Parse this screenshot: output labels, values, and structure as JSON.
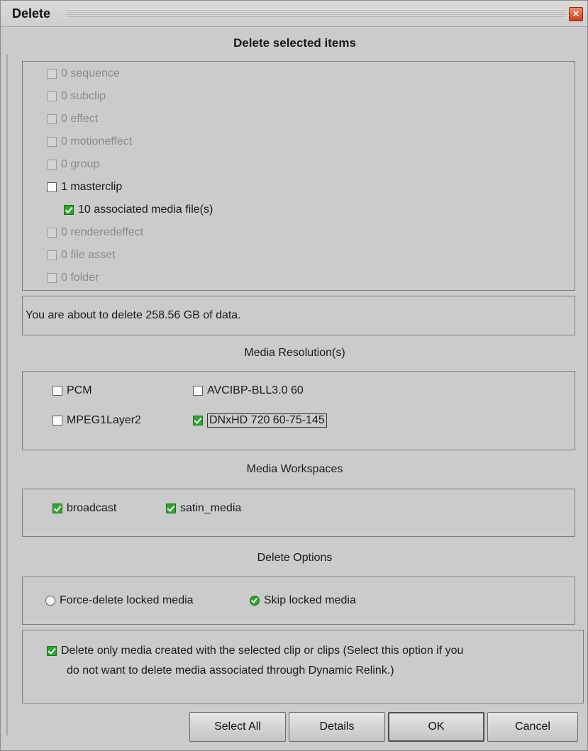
{
  "window": {
    "title": "Delete",
    "close_glyph": "×"
  },
  "heading": "Delete selected items",
  "items": [
    {
      "label": "0 sequence",
      "checked": false,
      "enabled": false,
      "indent": false
    },
    {
      "label": "0 subclip",
      "checked": false,
      "enabled": false,
      "indent": false
    },
    {
      "label": "0 effect",
      "checked": false,
      "enabled": false,
      "indent": false
    },
    {
      "label": "0 motioneffect",
      "checked": false,
      "enabled": false,
      "indent": false
    },
    {
      "label": "0 group",
      "checked": false,
      "enabled": false,
      "indent": false
    },
    {
      "label": "1 masterclip",
      "checked": false,
      "enabled": true,
      "indent": false
    },
    {
      "label": "10 associated media file(s)",
      "checked": true,
      "enabled": true,
      "indent": true
    },
    {
      "label": "0 renderedeffect",
      "checked": false,
      "enabled": false,
      "indent": false
    },
    {
      "label": "0 file asset",
      "checked": false,
      "enabled": false,
      "indent": false
    },
    {
      "label": "0 folder",
      "checked": false,
      "enabled": false,
      "indent": false
    }
  ],
  "summary": "You are about to delete 258.56 GB of data.",
  "media_resolutions": {
    "heading": "Media Resolution(s)",
    "options": [
      {
        "label": "PCM",
        "checked": false
      },
      {
        "label": "AVCIBP-BLL3.0 60",
        "checked": false
      },
      {
        "label": "MPEG1Layer2",
        "checked": false
      },
      {
        "label": "DNxHD 720 60-75-145",
        "checked": true
      }
    ]
  },
  "media_workspaces": {
    "heading": "Media Workspaces",
    "options": [
      {
        "label": "broadcast",
        "checked": true
      },
      {
        "label": "satin_media",
        "checked": true
      }
    ]
  },
  "delete_options": {
    "heading": "Delete Options",
    "force_label": "Force-delete locked media",
    "skip_label": "Skip locked media",
    "selected": "skip"
  },
  "only_media": {
    "checked": true,
    "line1": "Delete only media created with the selected clip or clips (Select this option if you",
    "line2": "do not want to delete media associated through Dynamic Relink.)"
  },
  "buttons": {
    "select_all": "Select All",
    "details": "Details",
    "ok": "OK",
    "cancel": "Cancel"
  }
}
